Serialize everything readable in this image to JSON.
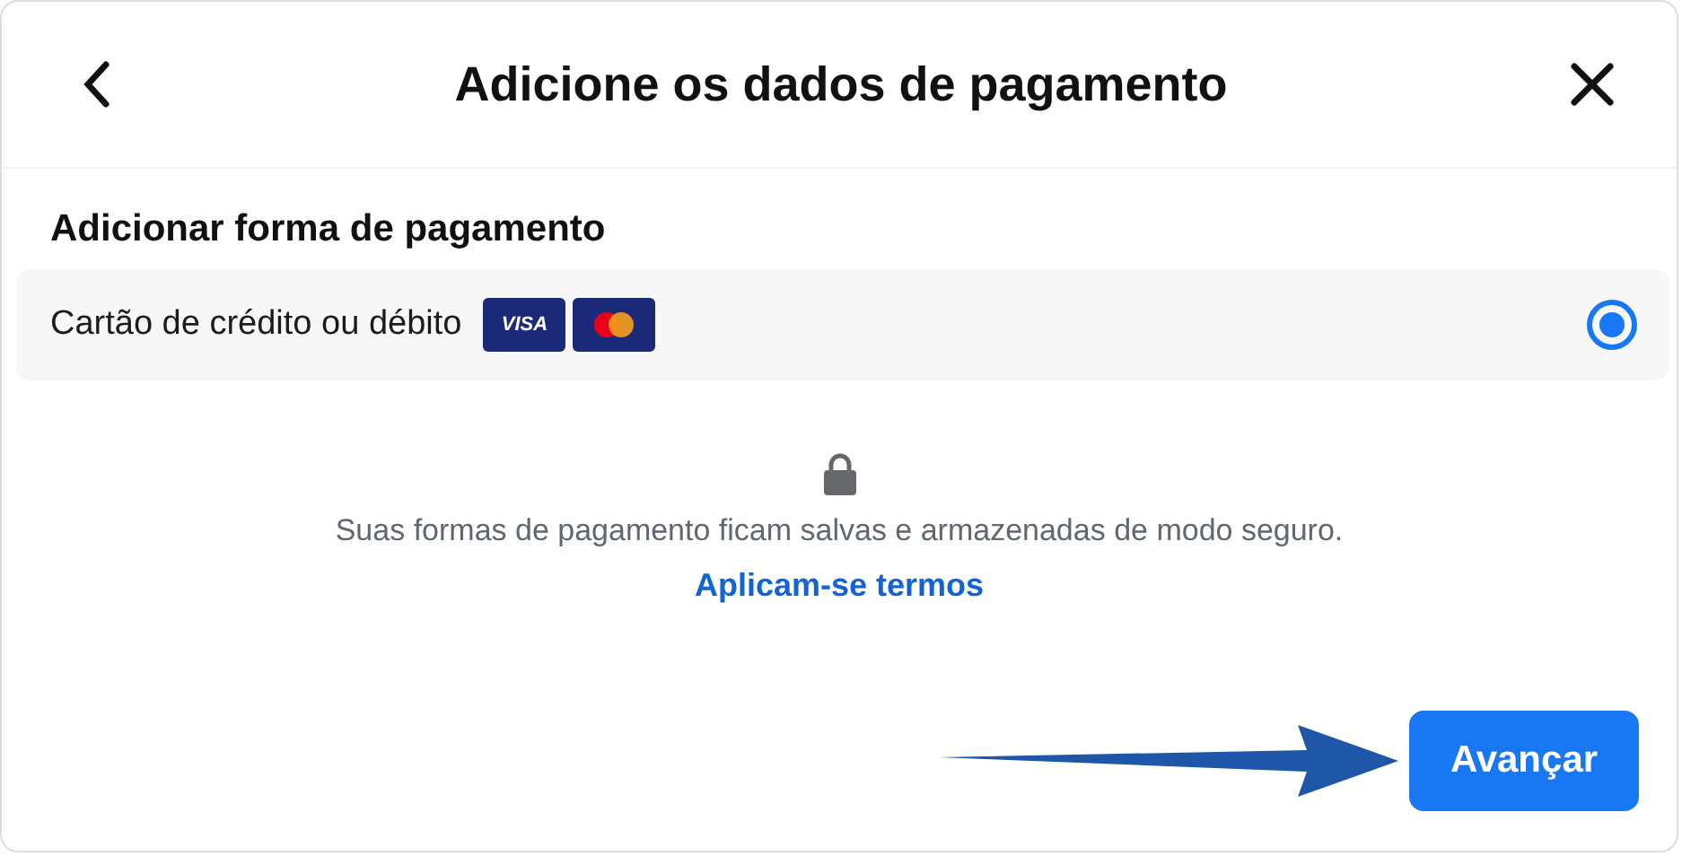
{
  "header": {
    "title": "Adicione os dados de pagamento"
  },
  "section": {
    "title": "Adicionar forma de pagamento"
  },
  "options": [
    {
      "label": "Cartão de crédito ou débito",
      "card_badge": "VISA",
      "selected": true
    }
  ],
  "notice": {
    "text": "Suas formas de pagamento ficam salvas e armazenadas de modo seguro.",
    "link": "Aplicam-se termos"
  },
  "button": "Avançar"
}
